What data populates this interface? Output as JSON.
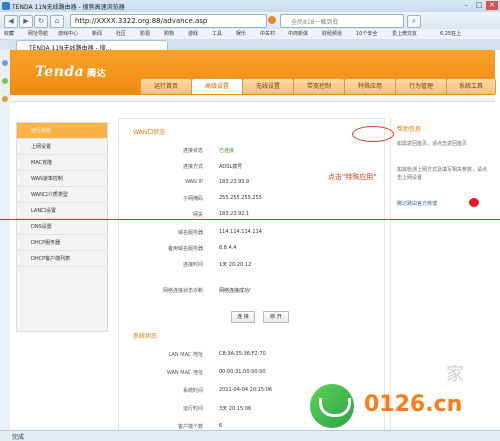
{
  "browser": {
    "window_title": "TENDA 11N无线路由器 - 搜狗高速浏览器",
    "url": "http://XXXX.3322.org:88/advance.asp",
    "tab_label": "TENDA 11N无线路由器 - 搜...",
    "search_placeholder": "全民818一触到底",
    "status_text": "完成",
    "bookmarks": [
      "收藏",
      "网址导航",
      "游戏中心",
      "新闻",
      "社区",
      "影视",
      "购物",
      "游戏",
      "工具",
      "娱乐",
      "中关村",
      "中商新体",
      "财经频道",
      "10个安全",
      "爱上微交友",
      "6.25狂上"
    ]
  },
  "router": {
    "brand": "Tenda",
    "brand_cn": "腾达",
    "nav_tabs": [
      "运行首页",
      "高级设置",
      "无线设置",
      "带宽控制",
      "特殊应用",
      "行为管理",
      "系统工具"
    ],
    "active_tab": "高级设置",
    "left_menu": [
      "运行状态",
      "上网设置",
      "MAC克隆",
      "WAN速率控制",
      "WAN口介质类型",
      "LAN口设置",
      "DNS设置",
      "DHCP服务器",
      "DHCP客户端列表"
    ],
    "wan": {
      "title": "WAN口状态",
      "rows": [
        {
          "label": "连接状态",
          "value": "已连接"
        },
        {
          "label": "连接方式",
          "value": "ADSL拨号"
        },
        {
          "label": "WAN IP",
          "value": "183.23.93.9"
        },
        {
          "label": "子网掩码",
          "value": "255.255.255.255"
        },
        {
          "label": "网关",
          "value": "183.23.92.1"
        },
        {
          "label": "域名服务器",
          "value": "114.114.114.114"
        },
        {
          "label": "备用域名服务器",
          "value": "8.8.4.4"
        },
        {
          "label": "连接时间",
          "value": "1天 20:20:12"
        }
      ],
      "diag_label": "网络连接状态诊断",
      "diag_value": "网络连接成功!",
      "btn_connect": "连 接",
      "btn_disconnect": "断 开"
    },
    "system": {
      "title": "系统状态",
      "rows": [
        {
          "label": "LAN MAC 地址",
          "value": "C8:3A:35:36:F2:70"
        },
        {
          "label": "WAN MAC 地址",
          "value": "00:00:31:00:00:00"
        },
        {
          "label": "系统时间",
          "value": "2011-04-04 20:15:06"
        },
        {
          "label": "运行时间",
          "value": "3天 20:15:06"
        },
        {
          "label": "客户端个数",
          "value": "6"
        }
      ]
    },
    "help": {
      "title": "帮助信息",
      "p1": "如需返回首页，请点击返回首页",
      "p2": "如需检测上网方式及填写相关参数，请点击上网设置",
      "p3": "腾达路由官方微博"
    },
    "annotation": "点击\"特殊应用\""
  },
  "watermark": {
    "text": "0126.cn",
    "char": "家"
  },
  "colors": {
    "orange": "#f08a10",
    "annotation_red": "#e03a1f",
    "green": "#3a9c2a"
  }
}
